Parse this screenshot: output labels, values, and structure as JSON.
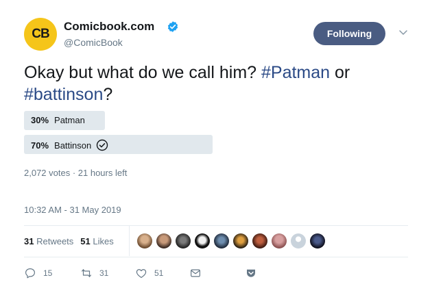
{
  "account": {
    "avatar_text": "CB",
    "display_name": "Comicbook.com",
    "handle": "@ComicBook",
    "verified": true
  },
  "follow_button": {
    "label": "Following"
  },
  "tweet": {
    "text_plain_1": "Okay but what do we call him? ",
    "hashtag_1": "#Patman",
    "text_plain_2": " or ",
    "hashtag_2": "#battinson",
    "text_plain_3": "?"
  },
  "poll": {
    "options": [
      {
        "percent": "30%",
        "label": "Patman",
        "share": 0.3,
        "selected": false
      },
      {
        "percent": "70%",
        "label": "Battinson",
        "share": 0.7,
        "selected": true
      }
    ],
    "meta": "2,072 votes · 21 hours left"
  },
  "timestamp": "10:32 AM - 31 May 2019",
  "stats": {
    "retweets_count": "31",
    "retweets_label": "Retweets",
    "likes_count": "51",
    "likes_label": "Likes"
  },
  "actions": {
    "reply_count": "15",
    "retweet_count": "31",
    "like_count": "51"
  },
  "colors": {
    "follow_button": "#4a5c82",
    "hashtag": "#2b4a86",
    "poll_bar": "#e1e8ed",
    "avatar": "#f5c51a",
    "verified": "#1da1f2"
  }
}
